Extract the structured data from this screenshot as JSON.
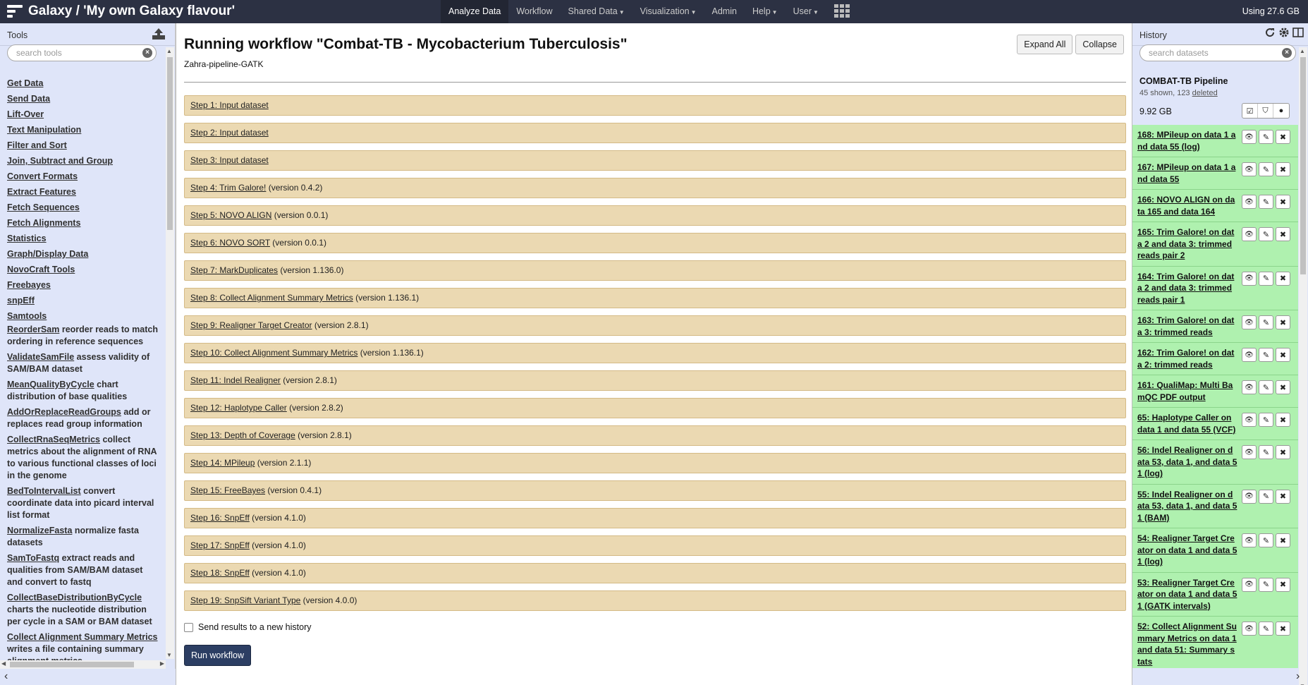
{
  "masthead": {
    "title": "Galaxy / 'My own Galaxy flavour'",
    "nav": [
      {
        "label": "Analyze Data",
        "dropdown": false
      },
      {
        "label": "Workflow",
        "dropdown": false
      },
      {
        "label": "Shared Data",
        "dropdown": true
      },
      {
        "label": "Visualization",
        "dropdown": true
      },
      {
        "label": "Admin",
        "dropdown": false
      },
      {
        "label": "Help",
        "dropdown": true
      },
      {
        "label": "User",
        "dropdown": true
      }
    ],
    "quota": "Using 27.6 GB"
  },
  "tools": {
    "title": "Tools",
    "search_placeholder": "search tools",
    "sections": [
      "Get Data",
      "Send Data",
      "Lift-Over",
      "Text Manipulation",
      "Filter and Sort",
      "Join, Subtract and Group",
      "Convert Formats",
      "Extract Features",
      "Fetch Sequences",
      "Fetch Alignments",
      "Statistics",
      "Graph/Display Data",
      "NovoCraft Tools",
      "Freebayes",
      "snpEff",
      "Samtools"
    ],
    "entries": [
      {
        "name": "ReorderSam",
        "desc": "reorder reads to match ordering in reference sequences"
      },
      {
        "name": "ValidateSamFile",
        "desc": "assess validity of SAM/BAM dataset"
      },
      {
        "name": "MeanQualityByCycle",
        "desc": "chart distribution of base qualities"
      },
      {
        "name": "AddOrReplaceReadGroups",
        "desc": "add or replaces read group information"
      },
      {
        "name": "CollectRnaSeqMetrics",
        "desc": "collect metrics about the alignment of RNA to various functional classes of loci in the genome"
      },
      {
        "name": "BedToIntervalList",
        "desc": "convert coordinate data into picard interval list format"
      },
      {
        "name": "NormalizeFasta",
        "desc": "normalize fasta datasets"
      },
      {
        "name": "SamToFastq",
        "desc": "extract reads and qualities from SAM/BAM dataset and convert to fastq"
      },
      {
        "name": "CollectBaseDistributionByCycle",
        "desc": "charts the nucleotide distribution per cycle in a SAM or BAM dataset"
      },
      {
        "name": "Collect Alignment Summary Metrics",
        "desc": "writes a file containing summary alignment metrics"
      }
    ]
  },
  "workflow": {
    "title": "Running workflow \"Combat-TB - Mycobacterium Tuberculosis\"",
    "subtitle": "Zahra-pipeline-GATK",
    "expand_all": "Expand All",
    "collapse": "Collapse",
    "steps": [
      {
        "label": "Step 1: Input dataset",
        "version": ""
      },
      {
        "label": "Step 2: Input dataset",
        "version": ""
      },
      {
        "label": "Step 3: Input dataset",
        "version": ""
      },
      {
        "label": "Step 4: Trim Galore!",
        "version": " (version 0.4.2)"
      },
      {
        "label": "Step 5: NOVO ALIGN",
        "version": " (version 0.0.1)"
      },
      {
        "label": "Step 6: NOVO SORT",
        "version": " (version 0.0.1)"
      },
      {
        "label": "Step 7: MarkDuplicates",
        "version": " (version 1.136.0)"
      },
      {
        "label": "Step 8: Collect Alignment Summary Metrics",
        "version": " (version 1.136.1)"
      },
      {
        "label": "Step 9: Realigner Target Creator",
        "version": " (version 2.8.1)"
      },
      {
        "label": "Step 10: Collect Alignment Summary Metrics",
        "version": " (version 1.136.1)"
      },
      {
        "label": "Step 11: Indel Realigner",
        "version": " (version 2.8.1)"
      },
      {
        "label": "Step 12: Haplotype Caller",
        "version": " (version 2.8.2)"
      },
      {
        "label": "Step 13: Depth of Coverage",
        "version": " (version 2.8.1)"
      },
      {
        "label": "Step 14: MPileup",
        "version": " (version 2.1.1)"
      },
      {
        "label": "Step 15: FreeBayes",
        "version": " (version 0.4.1)"
      },
      {
        "label": "Step 16: SnpEff",
        "version": " (version 4.1.0)"
      },
      {
        "label": "Step 17: SnpEff",
        "version": " (version 4.1.0)"
      },
      {
        "label": "Step 18: SnpEff",
        "version": " (version 4.1.0)"
      },
      {
        "label": "Step 19: SnpSift Variant Type",
        "version": " (version 4.0.0)"
      }
    ],
    "send_results_label": "Send results to a new history",
    "run_label": "Run workflow"
  },
  "history": {
    "title": "History",
    "search_placeholder": "search datasets",
    "name": "COMBAT-TB Pipeline",
    "shown": "45 shown, 123 ",
    "deleted": "deleted",
    "size": "9.92 GB",
    "datasets": [
      "168: MPileup on data 1 and data 55 (log)",
      "167: MPileup on data 1 and data 55",
      "166: NOVO ALIGN on data 165 and data 164",
      "165: Trim Galore! on data 2 and data 3: trimmed reads pair 2",
      "164: Trim Galore! on data 2 and data 3: trimmed reads pair 1",
      "163: Trim Galore! on data 3: trimmed reads",
      "162: Trim Galore! on data 2: trimmed reads",
      "161: QualiMap: Multi BamQC PDF output",
      "65: Haplotype Caller on data 1 and data 55 (VCF)",
      "56: Indel Realigner on data 53, data 1, and data 51 (log)",
      "55: Indel Realigner on data 53, data 1, and data 51 (BAM)",
      "54: Realigner Target Creator on data 1 and data 51 (log)",
      "53: Realigner Target Creator on data 1 and data 51 (GATK intervals)",
      "52: Collect Alignment Summary Metrics on data 1 and data 51: Summary stats"
    ]
  }
}
